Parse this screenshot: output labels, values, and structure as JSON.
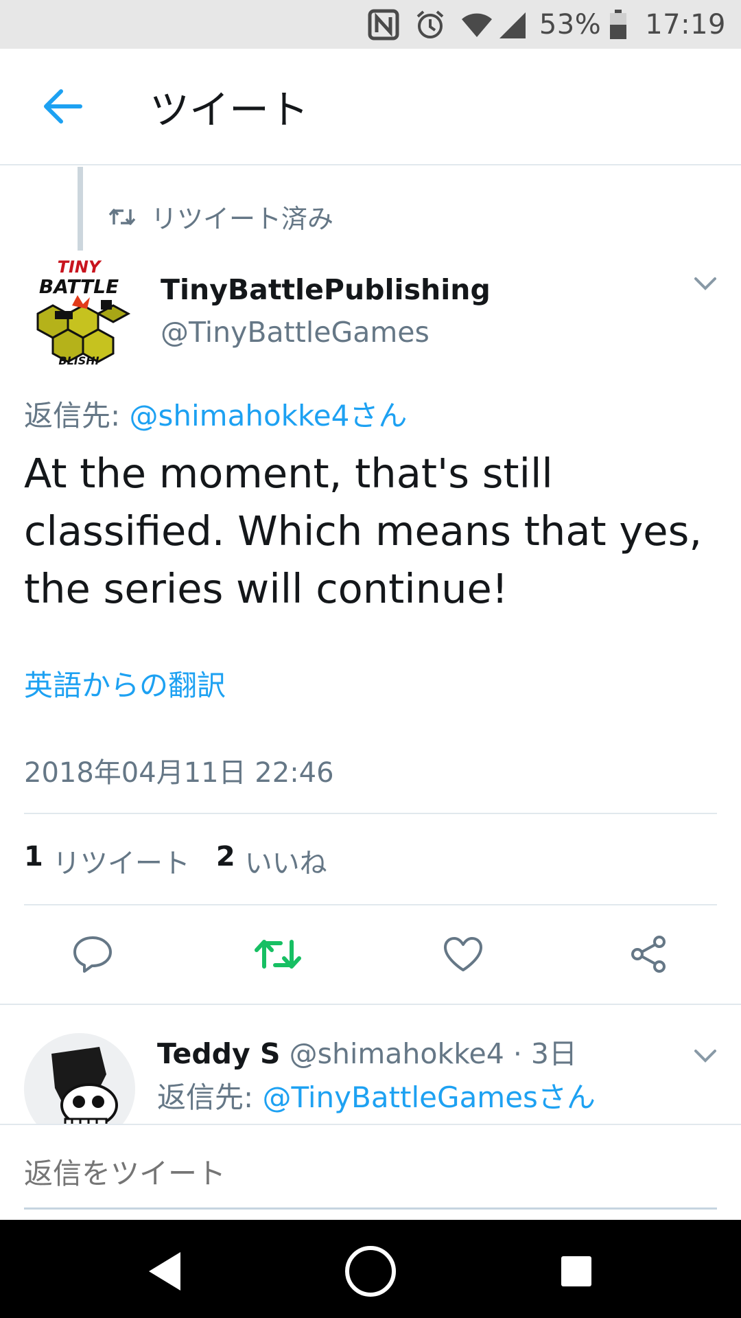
{
  "status_bar": {
    "battery": "53%",
    "time": "17:19",
    "icons": [
      "nfc-icon",
      "alarm-icon",
      "wifi-icon",
      "signal-icon",
      "battery-icon"
    ]
  },
  "header": {
    "title": "ツイート",
    "back_icon": "back-arrow-icon"
  },
  "retweet_context": {
    "label": "リツイート済み"
  },
  "tweet": {
    "author_name": "TinyBattlePublishing",
    "author_handle": "@TinyBattleGames",
    "avatar_text_top": "TINY",
    "avatar_text_mid": "BATTLE",
    "avatar_text_bottom": "BLISHI",
    "reply_prefix": "返信先: ",
    "reply_mention": "@shimahokke4さん",
    "text": "At the moment, that's still classified.  Which means that yes, the series will continue!",
    "translate": "英語からの翻訳",
    "timestamp": "2018年04月11日 22:46",
    "retweet_count": "1",
    "retweet_label": "リツイート",
    "like_count": "2",
    "like_label": "いいね"
  },
  "reply": {
    "name": "Teddy S",
    "handle": "@shimahokke4",
    "time": " · 3日",
    "reply_prefix": "返信先: ",
    "reply_mention": "@TinyBattleGamesさん"
  },
  "composer": {
    "placeholder": "返信をツイート"
  },
  "colors": {
    "accent": "#1da1f2",
    "retweet_green": "#17bf63",
    "secondary_text": "#657786"
  }
}
